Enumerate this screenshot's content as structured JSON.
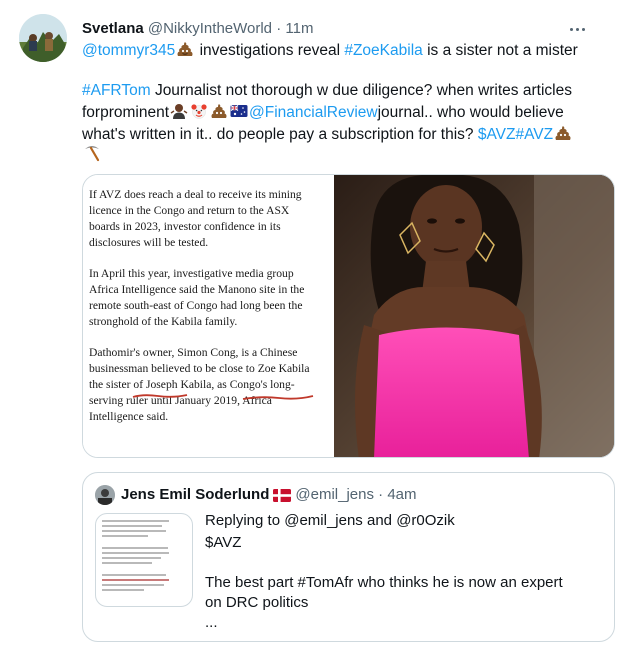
{
  "tweet": {
    "display_name": "Svetlana",
    "handle": "@NikkyIntheWorld",
    "separator": "·",
    "time": "11m",
    "more_icon": "more-horizontal-icon",
    "line1": {
      "mention": "@tommyr345",
      "text_a": "investigations reveal",
      "hashtag": "#ZoeKabila",
      "text_b": "is a sister not a mister"
    },
    "line2": {
      "hashtag": "#AFRTom",
      "text": "Journalist not thorough w due diligence? when writes articles"
    },
    "line3": {
      "text_a": "forprominent",
      "mention": "@FinancialReview",
      "text_b": "journal.. who would believe"
    },
    "line4": {
      "text": "what's written in it.. do people pay a subscription for this?",
      "cashtag": "$AVZ",
      "hashtag": "#AVZ"
    },
    "emojis": [
      "pile-of-poo",
      "person-shrugging",
      "clown-face",
      "pile-of-poo",
      "flag-australia",
      "pile-of-poo",
      "pick"
    ]
  },
  "media": {
    "article_paragraphs": [
      [
        "If AVZ does reach a deal to receive its mining",
        "licence in the Congo and return to the ASX",
        "boards in 2023, investor confidence in its",
        "disclosures will be tested."
      ],
      [
        "In April this year, investigative media group",
        "Africa Intelligence said the Manono site in the",
        "remote south-east of Congo had long been the",
        "stronghold of the Kabila family."
      ],
      [
        "Dathomir's owner, Simon Cong, is a Chinese",
        "businessman believed to be close to Zoe Kabila",
        "the sister of Joseph Kabila, as Congo's long-",
        "serving ruler until January 2019, Africa",
        "Intelligence said."
      ]
    ]
  },
  "quote": {
    "display_name": "Jens Emil Soderlund",
    "flag": "flag-denmark",
    "handle": "@emil_jens",
    "separator": "·",
    "time": "4am",
    "replying_prefix": "Replying to",
    "replying_user1": "@emil_jens",
    "replying_and": "and",
    "replying_user2": "@r0Ozik",
    "line1": "$AVZ",
    "line2": "The best part #TomAfr who thinks he is now an expert",
    "line3": "on DRC politics",
    "line4": "..."
  },
  "colors": {
    "link": "#1d9bf0",
    "text": "#0f1419",
    "muted": "#536471",
    "border": "#cfd9de",
    "dress_pink": "#ff3fae"
  }
}
